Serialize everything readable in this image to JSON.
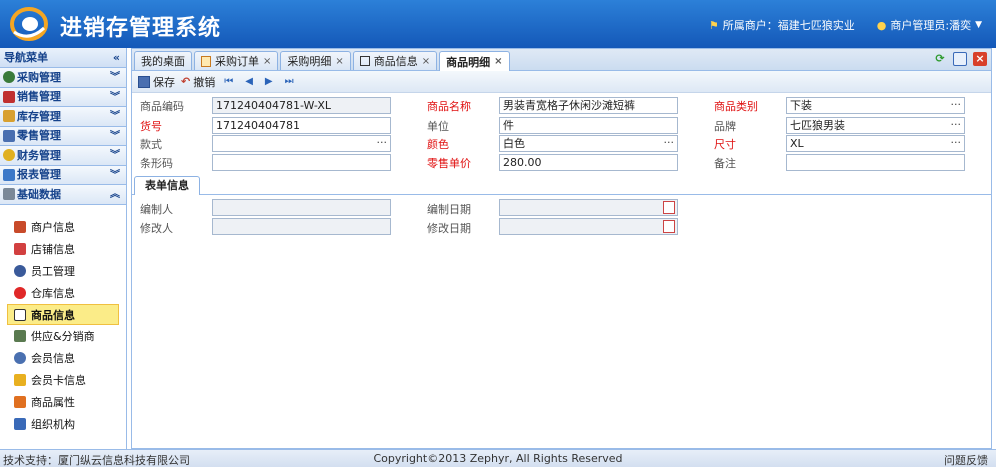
{
  "header": {
    "title": "进销存管理系统",
    "merchant": "所属商户：福建七匹狼实业",
    "admin": "商户管理员:潘奕"
  },
  "sidebar": {
    "title": "导航菜单",
    "groups": [
      {
        "label": "采购管理"
      },
      {
        "label": "销售管理"
      },
      {
        "label": "库存管理"
      },
      {
        "label": "零售管理"
      },
      {
        "label": "财务管理"
      },
      {
        "label": "报表管理"
      },
      {
        "label": "基础数据"
      }
    ],
    "items": [
      {
        "label": "商户信息"
      },
      {
        "label": "店铺信息"
      },
      {
        "label": "员工管理"
      },
      {
        "label": "仓库信息"
      },
      {
        "label": "商品信息"
      },
      {
        "label": "供应&分销商"
      },
      {
        "label": "会员信息"
      },
      {
        "label": "会员卡信息"
      },
      {
        "label": "商品属性"
      },
      {
        "label": "组织机构"
      }
    ]
  },
  "tabs": [
    {
      "label": "我的桌面"
    },
    {
      "label": "采购订单"
    },
    {
      "label": "采购明细"
    },
    {
      "label": "商品信息"
    },
    {
      "label": "商品明细"
    }
  ],
  "toolbar": {
    "save": "保存",
    "undo": "撤销"
  },
  "form": {
    "code_label": "商品编码",
    "code_value": "171240404781-W-XL",
    "name_label": "商品名称",
    "name_value": "男装青宽格子休闲沙滩短裤",
    "category_label": "商品类别",
    "category_value": "下装",
    "sku_label": "货号",
    "sku_value": "171240404781",
    "unit_label": "单位",
    "unit_value": "件",
    "brand_label": "品牌",
    "brand_value": "七匹狼男装",
    "style_label": "款式",
    "style_value": "",
    "color_label": "颜色",
    "color_value": "白色",
    "size_label": "尺寸",
    "size_value": "XL",
    "barcode_label": "条形码",
    "barcode_value": "",
    "price_label": "零售单价",
    "price_value": "280.00",
    "remark_label": "备注",
    "remark_value": ""
  },
  "subtab": {
    "label": "表单信息",
    "creator_label": "编制人",
    "created_date_label": "编制日期",
    "modifier_label": "修改人",
    "modified_date_label": "修改日期"
  },
  "footer": {
    "support": "技术支持：厦门纵云信息科技有限公司",
    "copyright": "Copyright©2013 Zephyr, All Rights Reserved",
    "feedback": "问题反馈"
  }
}
